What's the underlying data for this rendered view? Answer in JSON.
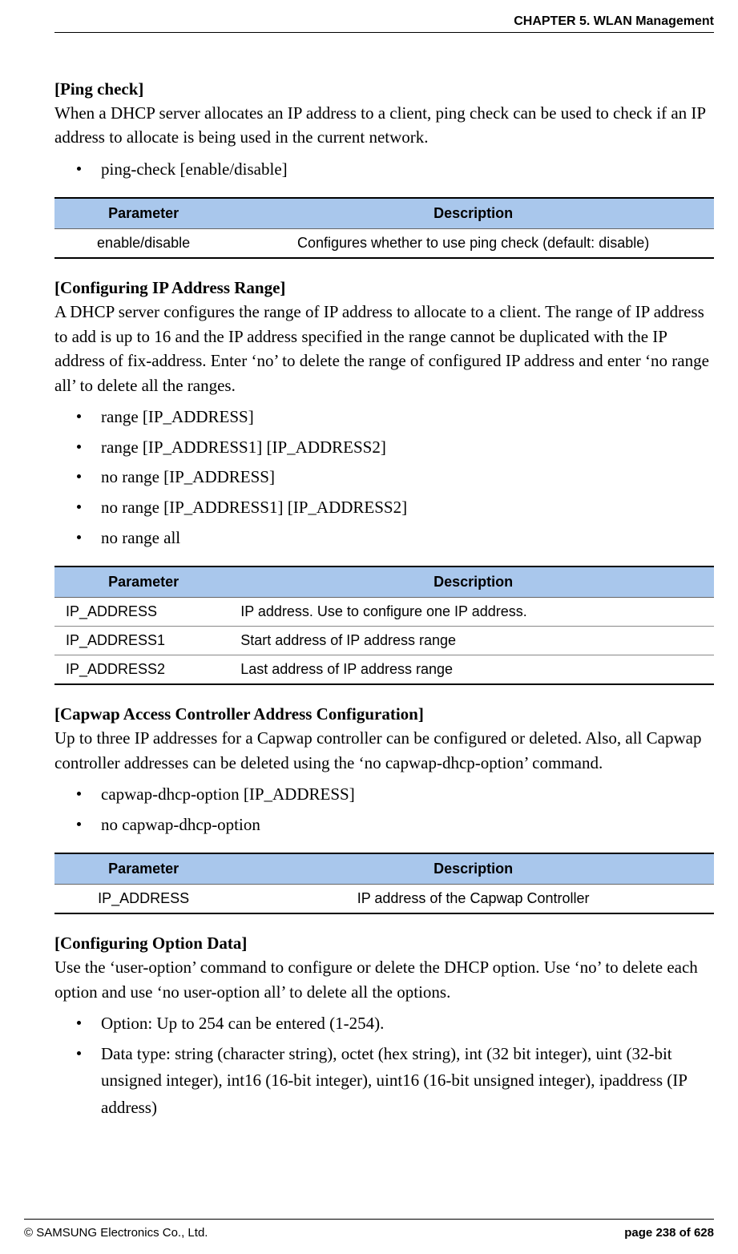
{
  "header": "CHAPTER 5. WLAN Management",
  "s1": {
    "title": "[Ping check]",
    "body": "When a DHCP server allocates an IP address to a client, ping check can be used to check if an IP address to allocate is being used in the current network.",
    "bullets": [
      "ping-check [enable/disable]"
    ],
    "th1": "Parameter",
    "th2": "Description",
    "rows": [
      {
        "p": "enable/disable",
        "d": "Configures whether to use ping check (default: disable)"
      }
    ]
  },
  "s2": {
    "title": "[Configuring IP Address Range]",
    "body": "A DHCP server configures the range of IP address to allocate to a client. The range of IP address to add is up to 16 and the IP address specified in the range cannot be duplicated with the IP address of fix-address. Enter ‘no’ to delete the range of configured IP address and enter ‘no range all’ to delete all the ranges.",
    "bullets": [
      "range [IP_ADDRESS]",
      "range [IP_ADDRESS1] [IP_ADDRESS2]",
      "no range [IP_ADDRESS]",
      "no range [IP_ADDRESS1] [IP_ADDRESS2]",
      "no range all"
    ],
    "th1": "Parameter",
    "th2": "Description",
    "rows": [
      {
        "p": "IP_ADDRESS",
        "d": "IP address. Use to configure one IP address."
      },
      {
        "p": "IP_ADDRESS1",
        "d": "Start address of IP address range"
      },
      {
        "p": "IP_ADDRESS2",
        "d": "Last address of IP address range"
      }
    ]
  },
  "s3": {
    "title": "[Capwap Access Controller Address Configuration]",
    "body": "Up to three IP addresses for a Capwap controller can be configured or deleted. Also, all Capwap controller addresses can be deleted using the ‘no capwap-dhcp-option’ command.",
    "bullets": [
      "capwap-dhcp-option [IP_ADDRESS]",
      "no capwap-dhcp-option"
    ],
    "th1": "Parameter",
    "th2": "Description",
    "rows": [
      {
        "p": "IP_ADDRESS",
        "d": "IP address of the Capwap Controller"
      }
    ]
  },
  "s4": {
    "title": "[Configuring Option Data]",
    "body": "Use the ‘user-option’ command to configure or delete the DHCP option. Use ‘no’ to delete each option and use ‘no user-option all’ to delete all the options.",
    "bullets": [
      "Option: Up to 254 can be entered (1-254).",
      "Data type: string (character string), octet (hex string), int (32 bit integer), uint (32-bit unsigned integer), int16 (16-bit integer), uint16 (16-bit unsigned integer), ipaddress (IP address)"
    ]
  },
  "footer": {
    "left": "© SAMSUNG Electronics Co., Ltd.",
    "right": "page 238 of 628"
  }
}
